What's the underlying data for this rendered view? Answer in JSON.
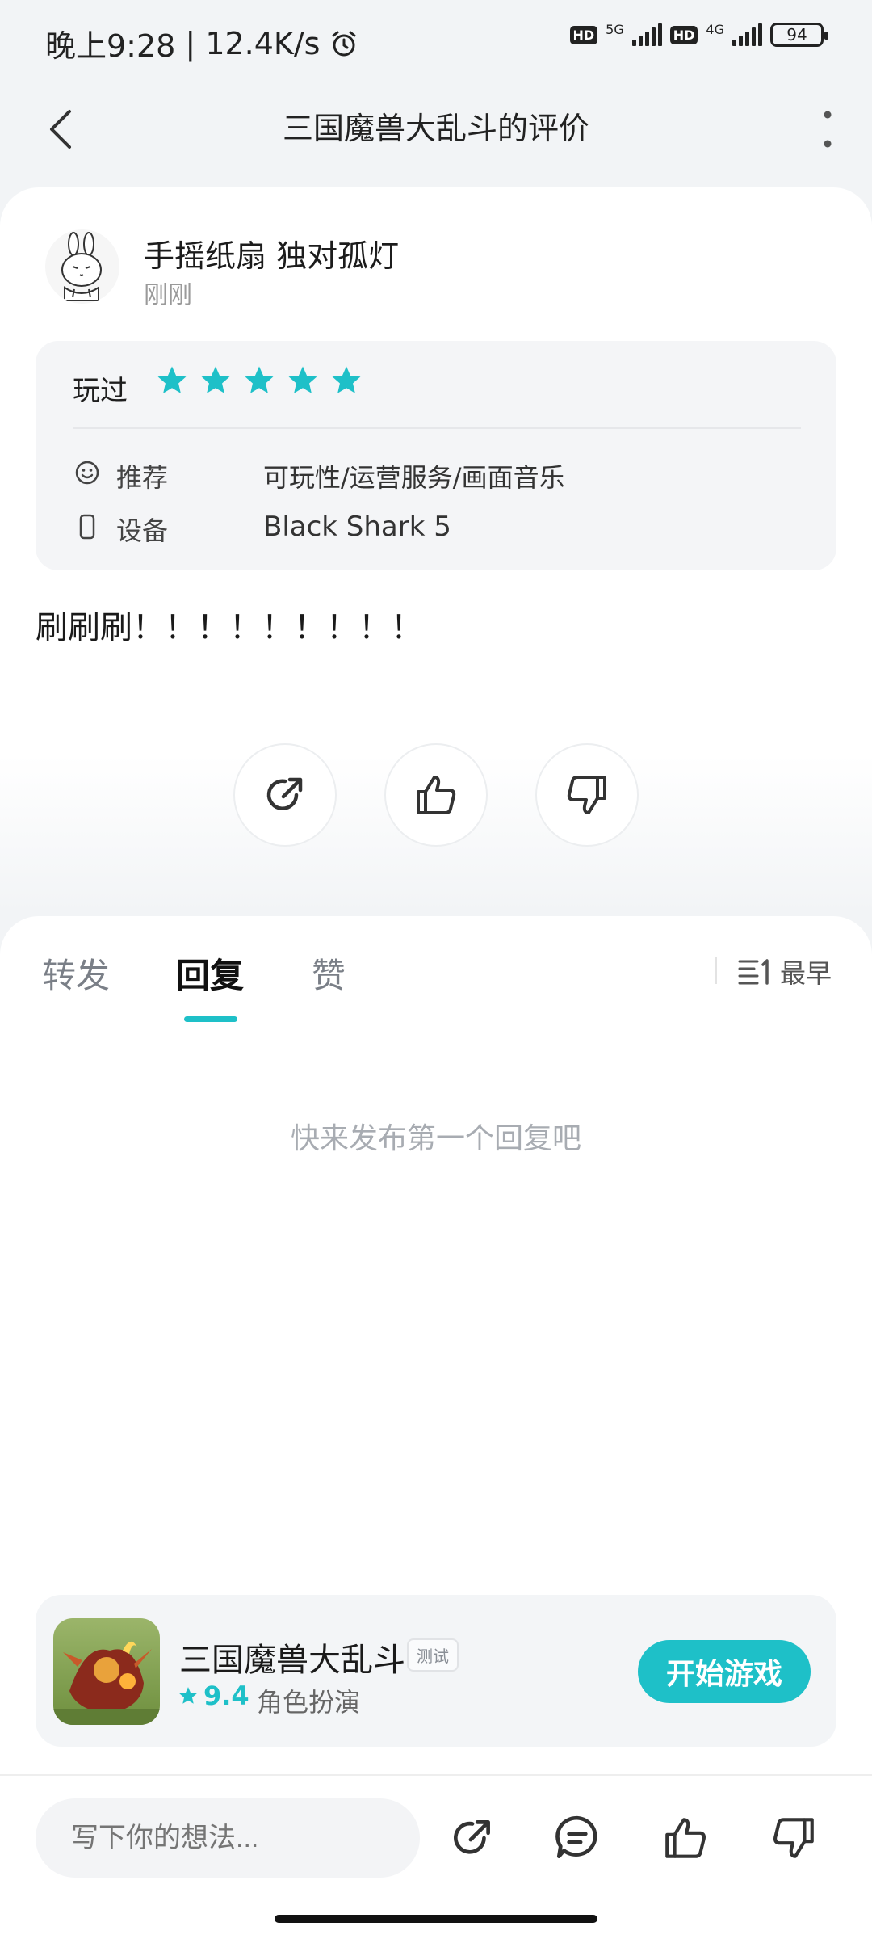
{
  "status_bar": {
    "time": "晚上9:28",
    "speed": "12.4K/s",
    "hd1": "HD",
    "net1": "5G",
    "hd2": "HD",
    "net2": "4G",
    "battery": "94"
  },
  "header": {
    "title": "三国魔兽大乱斗的评价"
  },
  "review": {
    "username": "手摇纸扇 独对孤灯",
    "time": "刚刚",
    "played_label": "玩过",
    "rating": 5,
    "recommend_label": "推荐",
    "recommend_value": "可玩性/运营服务/画面音乐",
    "device_label": "设备",
    "device_value": "Black Shark 5",
    "text": "刷刷刷！！！！！！！！！"
  },
  "tabs": {
    "forward": "转发",
    "reply": "回复",
    "like": "赞",
    "sort": "最早"
  },
  "empty_text": "快来发布第一个回复吧",
  "game": {
    "name": "三国魔兽大乱斗",
    "tag": "测试",
    "rating": "9.4",
    "genre": "角色扮演",
    "play_button": "开始游戏"
  },
  "bottom": {
    "placeholder": "写下你的想法..."
  },
  "colors": {
    "accent": "#1ec0c8"
  }
}
